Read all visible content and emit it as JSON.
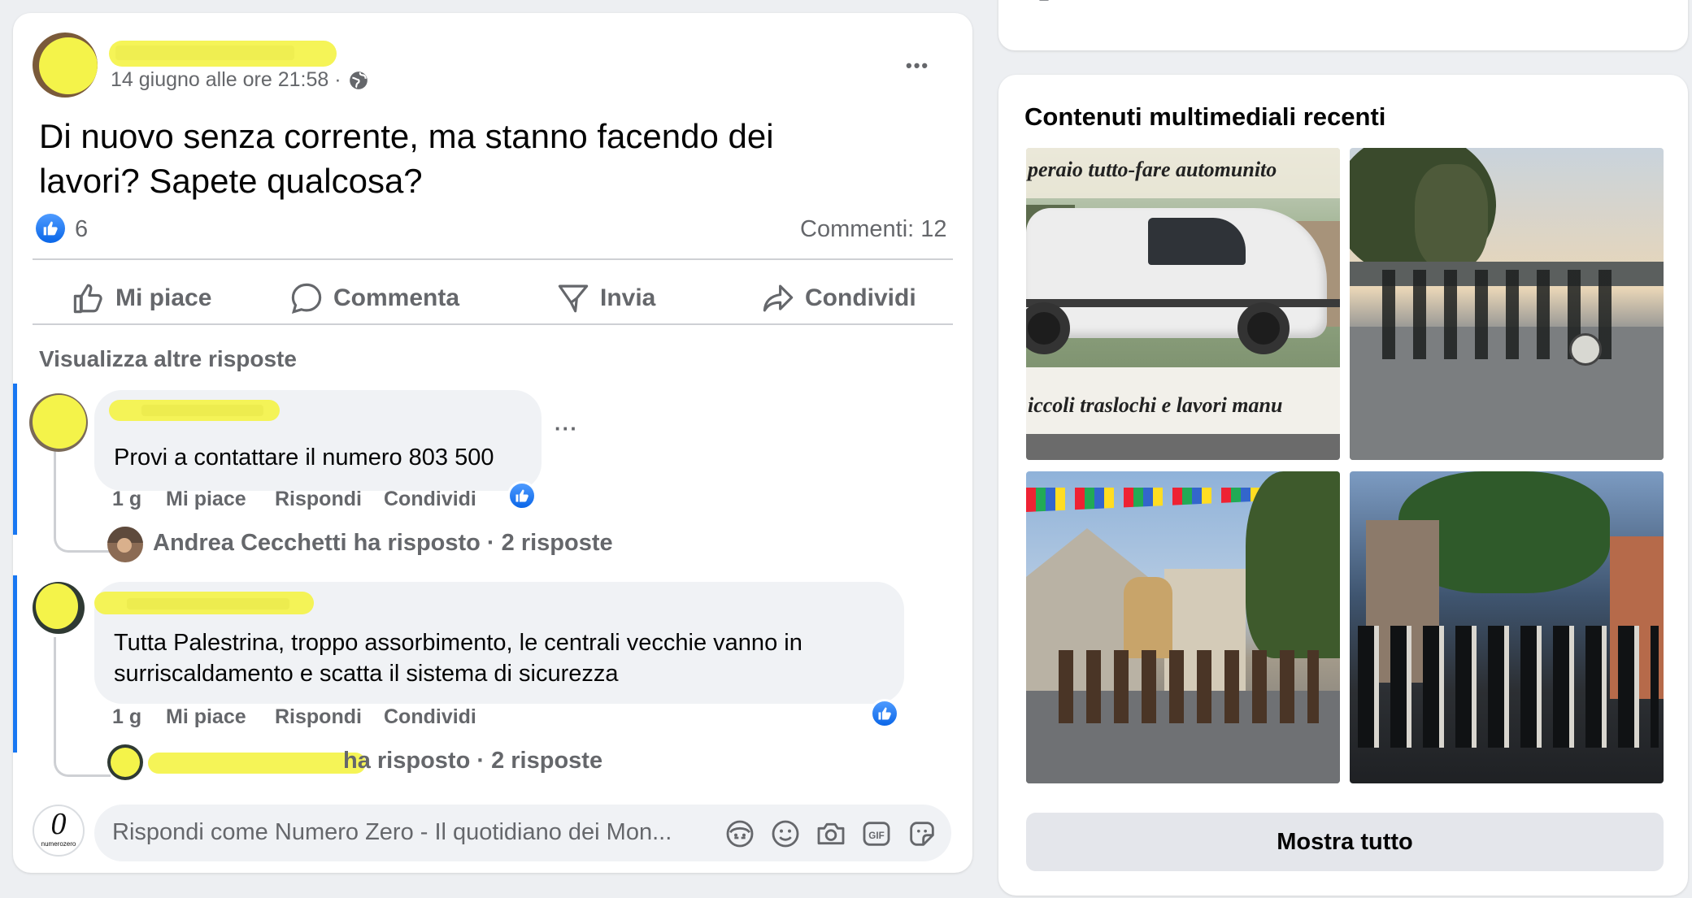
{
  "post": {
    "timestamp": "14 giugno alle ore 21:58 ·",
    "text_line1": "Di nuovo senza corrente, ma stanno facendo dei",
    "text_line2": "lavori? Sapete qualcosa?",
    "like_count": "6",
    "comments_count": "Commenti: 12",
    "more_label": "•••"
  },
  "actions": {
    "like": "Mi piace",
    "comment": "Commenta",
    "send": "Invia",
    "share": "Condividi"
  },
  "comments": {
    "view_more": "Visualizza altre risposte",
    "c1": {
      "text": "Provi a contattare il numero 803 500",
      "time": "1 g",
      "like": "Mi piace",
      "reply": "Rispondi",
      "share": "Condividi",
      "more": "···",
      "reply_summary": "Andrea Cecchetti ha risposto · 2 risposte"
    },
    "c2": {
      "text_line1": "Tutta Palestrina, troppo assorbimento, le centrali vecchie vanno in",
      "text_line2": "surriscaldamento e scatta il sistema di sicurezza",
      "time": "1 g",
      "like": "Mi piace",
      "reply": "Rispondi",
      "share": "Condividi",
      "reply_summary": "ha risposto · 2 risposte"
    }
  },
  "composer": {
    "placeholder": "Rispondi come Numero Zero - Il quotidiano dei Mon...",
    "page_logo": "0",
    "page_logo_caption": "numerozero",
    "icons": [
      "avatar-sticker-icon",
      "emoji-icon",
      "camera-icon",
      "gif-icon",
      "sticker-icon"
    ]
  },
  "media": {
    "title": "Contenuti multimediali recenti",
    "photo1_top": "peraio tutto-fare  automunito",
    "photo1_bottom": "iccoli traslochi e lavori manu",
    "show_all": "Mostra tutto"
  },
  "colors": {
    "accent": "#1877f2",
    "highlight": "#f4f34a",
    "secondary_text": "#65676b"
  }
}
